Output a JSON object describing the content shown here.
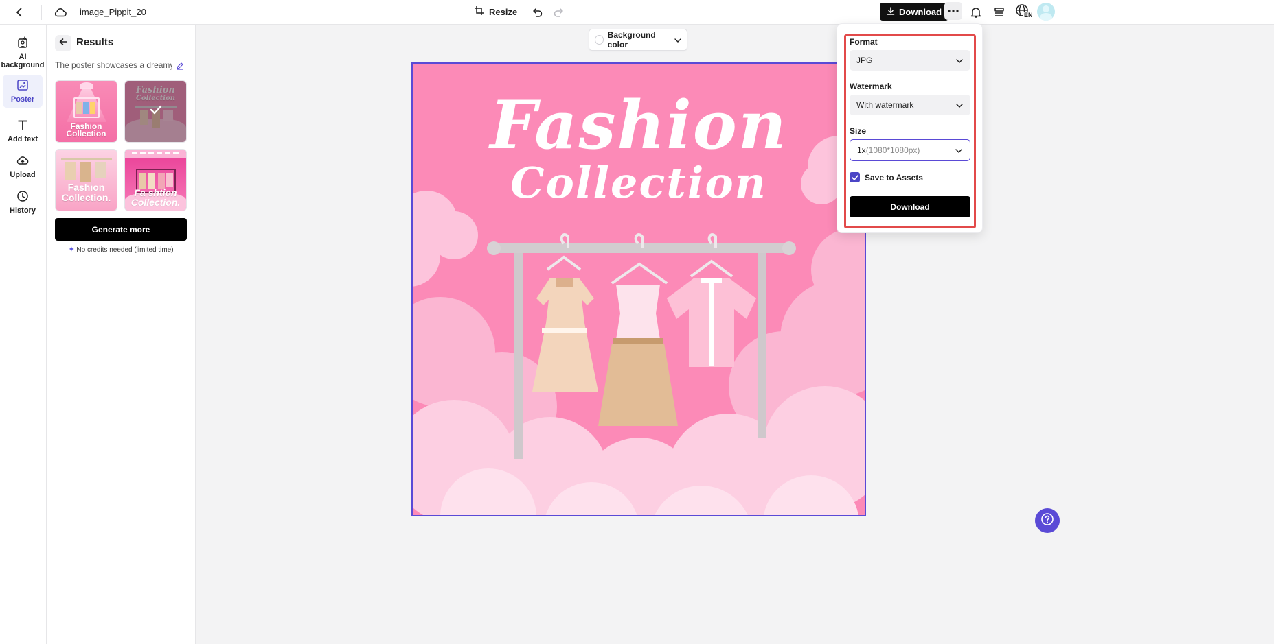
{
  "header": {
    "filename": "image_Pippit_20",
    "resize_label": "Resize",
    "download_label": "Download",
    "language_badge": "EN"
  },
  "rail": {
    "items": [
      {
        "label": "AI background",
        "icon": "ai-background-icon"
      },
      {
        "label": "Poster",
        "icon": "poster-icon",
        "active": true
      },
      {
        "label": "Add text",
        "icon": "text-icon"
      },
      {
        "label": "Upload",
        "icon": "upload-cloud-icon"
      },
      {
        "label": "History",
        "icon": "clock-icon"
      }
    ]
  },
  "panel": {
    "title": "Results",
    "prompt": "The poster showcases a dreamy...",
    "thumbnails": [
      {
        "line1": "Fashion",
        "line2": "Collection"
      },
      {
        "line1": "Fashion",
        "line2": "Collection",
        "selected": true
      },
      {
        "line1": "Fashion",
        "line2": "Collection."
      },
      {
        "line1": "Fa shtion",
        "line2": "Collection."
      }
    ],
    "generate_label": "Generate more",
    "credits_note": "No credits needed (limited time)"
  },
  "canvas": {
    "background_color_label": "Background color",
    "poster_title_1": "Fashion",
    "poster_title_2": "Collection"
  },
  "download_menu": {
    "format_label": "Format",
    "format_value": "JPG",
    "watermark_label": "Watermark",
    "watermark_value": "With watermark",
    "size_label": "Size",
    "size_value_main": "1x",
    "size_value_detail": "(1080*1080px)",
    "save_to_assets_label": "Save to Assets",
    "save_to_assets_checked": true,
    "download_button_label": "Download"
  },
  "colors": {
    "accent": "#5a4ad6",
    "poster_pink": "#fc8ab7",
    "highlight_red": "#e24a4a"
  }
}
